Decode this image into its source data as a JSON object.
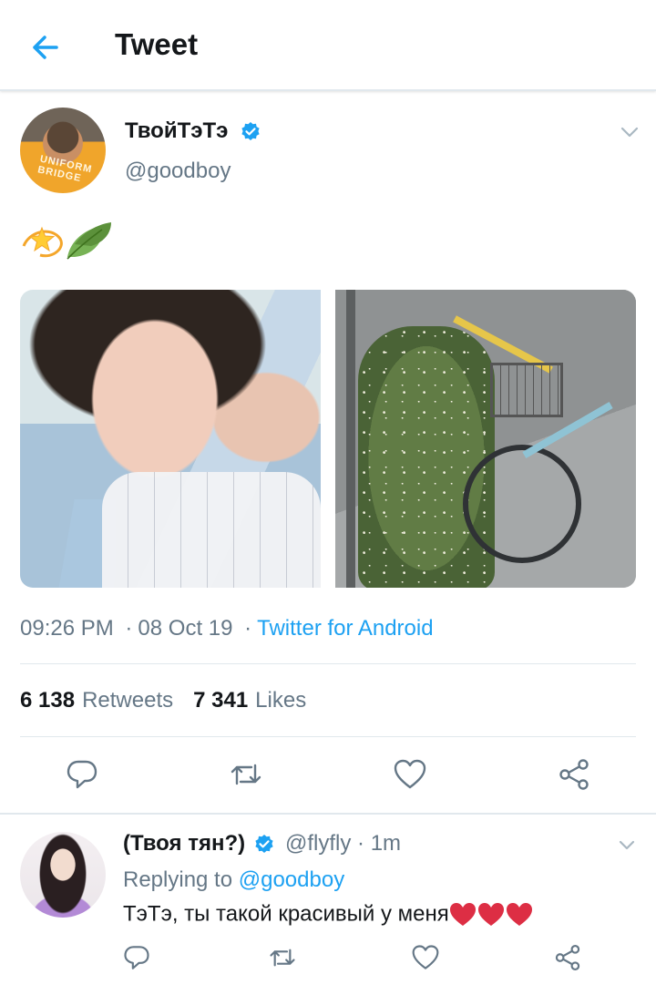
{
  "header": {
    "title": "Tweet"
  },
  "tweet": {
    "author_name": "ТвойТэТэ",
    "author_handle": "@goodboy",
    "avatar_shirt_text": "UNIFORM BRIDGE",
    "text_emojis": [
      "dizzy-star",
      "leaf"
    ],
    "time": "09:26 PM",
    "sep1": "·",
    "date": "08 Oct 19",
    "sep2": "·",
    "source": "Twitter for Android",
    "retweets_count": "6 138",
    "retweets_label": "Retweets",
    "likes_count": "7 341",
    "likes_label": "Likes"
  },
  "reply": {
    "name": "(Твоя тян?)",
    "handle_time": "@flyfly · 1m",
    "replying_prefix": "Replying to",
    "replying_to": "@goodboy",
    "text": "ТэТэ, ты такой красивый у меня",
    "hearts": 3
  },
  "colors": {
    "accent": "#1da1f2",
    "secondary_text": "#657786",
    "primary_text": "#14171a",
    "divider": "#e1e8ed",
    "heart": "#e0245e"
  }
}
